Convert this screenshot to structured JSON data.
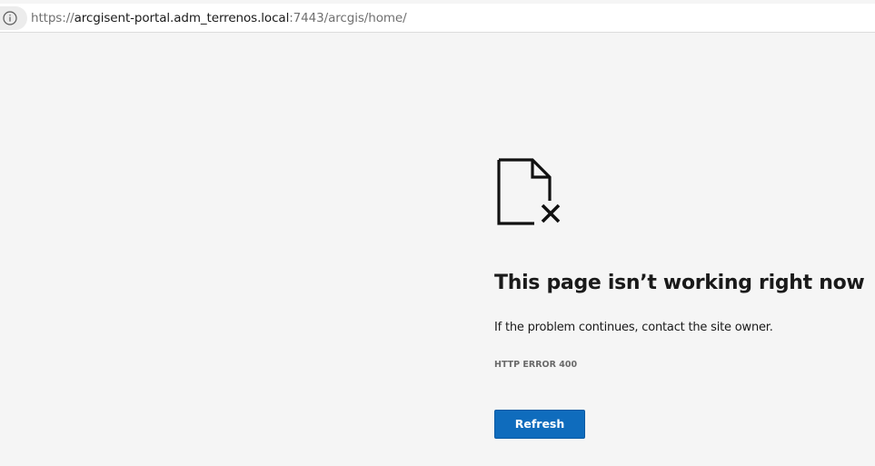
{
  "address_bar": {
    "info_icon": "info-circle-icon",
    "url_scheme": "https://",
    "url_host": "arcgisent-portal.adm_terrenos.local",
    "url_rest": ":7443/arcgis/home/"
  },
  "error_page": {
    "icon": "broken-document-icon",
    "title": "This page isn’t working right now",
    "message": "If the problem continues, contact the site owner.",
    "error_code": "HTTP ERROR 400",
    "refresh_label": "Refresh"
  },
  "colors": {
    "page_background": "#f5f5f5",
    "button_accent": "#0f6cbd",
    "title_text": "#1a1a1a",
    "muted_text": "#6a6a6a"
  }
}
